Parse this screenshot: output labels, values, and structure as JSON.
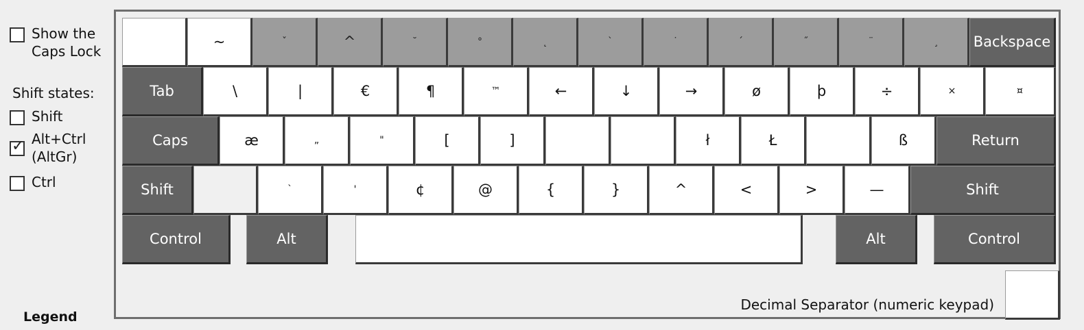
{
  "sidebar": {
    "show_caps_lock": {
      "label_line1": "Show the",
      "label_line2": "Caps Lock",
      "checked": false
    },
    "shift_states_title": "Shift states:",
    "shift": {
      "label": "Shift",
      "checked": false
    },
    "altgr": {
      "label_line1": "Alt+Ctrl",
      "label_line2": "(AltGr)",
      "checked": true
    },
    "ctrl": {
      "label": "Ctrl",
      "checked": false
    },
    "legend": "Legend",
    "check_glyph": "✓"
  },
  "keyboard": {
    "row1": [
      "",
      "~",
      "ˇ",
      "^",
      "˘",
      "°",
      "˛",
      "`",
      "˙",
      "´",
      "˝",
      "¨",
      "¸",
      "Backspace"
    ],
    "row2": [
      "Tab",
      "\\",
      "|",
      "€",
      "¶",
      "™",
      "←",
      "↓",
      "→",
      "ø",
      "þ",
      "÷",
      "×",
      "¤"
    ],
    "row3": [
      "Caps",
      "æ",
      "„",
      "\"",
      "[",
      "]",
      "",
      "",
      "ł",
      "Ł",
      "",
      "ß",
      "Return"
    ],
    "row4": [
      "Shift",
      "",
      "`",
      "'",
      "¢",
      "@",
      "{",
      "}",
      "^",
      "<",
      ">",
      "—",
      "Shift"
    ],
    "row5": [
      "Control",
      "Alt",
      "",
      "Alt",
      "Control"
    ],
    "decimal_separator_label": "Decimal Separator (numeric keypad)",
    "decimal_separator_value": ""
  }
}
